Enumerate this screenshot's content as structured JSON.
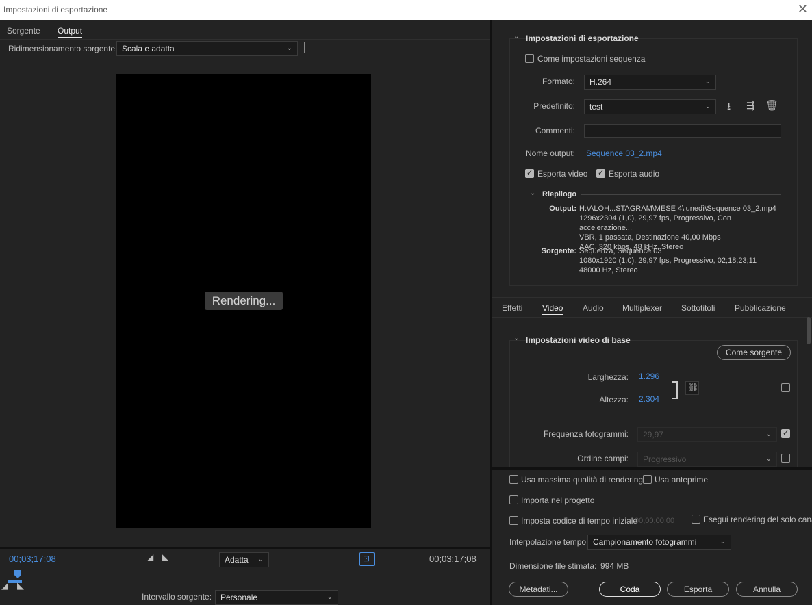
{
  "window": {
    "title": "Impostazioni di esportazione"
  },
  "left": {
    "tabs": [
      {
        "label": "Sorgente"
      },
      {
        "label": "Output"
      }
    ],
    "scaling_label": "Ridimensionamento sorgente:",
    "scaling_value": "Scala e adatta",
    "rendering_text": "Rendering...",
    "timecode_in": "00;03;17;08",
    "timecode_out": "00;03;17;08",
    "fit_value": "Adatta",
    "range_label": "Intervallo sorgente:",
    "range_value": "Personale"
  },
  "export": {
    "section_title": "Impostazioni di esportazione",
    "match_sequence": "Come impostazioni sequenza",
    "format_label": "Formato:",
    "format_value": "H.264",
    "preset_label": "Predefinito:",
    "preset_value": "test",
    "comments_label": "Commenti:",
    "output_name_label": "Nome output:",
    "output_name_value": "Sequence 03_2.mp4",
    "export_video": "Esporta video",
    "export_audio": "Esporta audio",
    "summary_title": "Riepilogo",
    "output_label": "Output:",
    "output_lines": [
      "H:\\ALOH...STAGRAM\\MESE 4\\lunedì\\Sequence 03_2.mp4",
      "1296x2304 (1,0), 29,97 fps, Progressivo, Con accelerazione...",
      "VBR, 1 passata, Destinazione 40,00 Mbps",
      "AAC, 320 kbps, 48 kHz, Stereo"
    ],
    "source_label": "Sorgente:",
    "source_lines": [
      "Sequenza, Sequence 03",
      "1080x1920 (1,0), 29,97 fps, Progressivo, 02;18;23;11",
      "48000 Hz, Stereo"
    ]
  },
  "tabs2": [
    {
      "label": "Effetti"
    },
    {
      "label": "Video"
    },
    {
      "label": "Audio"
    },
    {
      "label": "Multiplexer"
    },
    {
      "label": "Sottotitoli"
    },
    {
      "label": "Pubblicazione"
    }
  ],
  "video": {
    "section_title": "Impostazioni video di base",
    "match_source": "Come sorgente",
    "width_label": "Larghezza:",
    "width_value": "1.296",
    "height_label": "Altezza:",
    "height_value": "2.304",
    "framerate_label": "Frequenza fotogrammi:",
    "framerate_value": "29,97",
    "field_order_label": "Ordine campi:",
    "field_order_value": "Progressivo"
  },
  "bottom": {
    "max_quality": "Usa massima qualità di rendering",
    "use_previews": "Usa anteprime",
    "import_project": "Importa nel progetto",
    "set_timecode": "Imposta codice di tempo iniziale",
    "timecode_placeholder": "00;00;00;00",
    "alpha_only": "Esegui rendering del solo canale",
    "time_interp_label": "Interpolazione tempo:",
    "time_interp_value": "Campionamento fotogrammi",
    "file_size_label": "Dimensione file stimata:",
    "file_size_value": "994 MB",
    "metadata_btn": "Metadati...",
    "queue_btn": "Coda",
    "export_btn": "Esporta",
    "cancel_btn": "Annulla"
  },
  "colors": {
    "accent": "#4a8fe0",
    "background": "#232323"
  }
}
